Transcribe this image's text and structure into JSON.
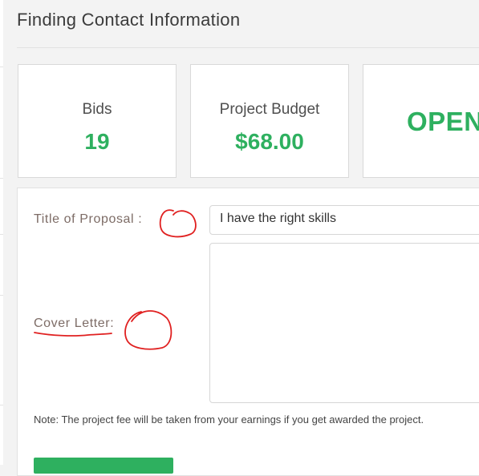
{
  "page": {
    "title": "Finding Contact Information"
  },
  "stats": {
    "bids_label": "Bids",
    "bids_value": "19",
    "budget_label": "Project Budget",
    "budget_value": "$68.00",
    "status_value": "OPEN"
  },
  "form": {
    "proposal_title_label": "Title of Proposal :",
    "proposal_title_value": "I have the right skills",
    "cover_letter_label": "Cover Letter:",
    "cover_letter_value": "",
    "note": "Note: The project fee will be taken from your earnings if you get awarded the project.",
    "submit_label": ""
  },
  "colors": {
    "accent_green": "#2eb05f",
    "annotation_red": "#e02020"
  }
}
